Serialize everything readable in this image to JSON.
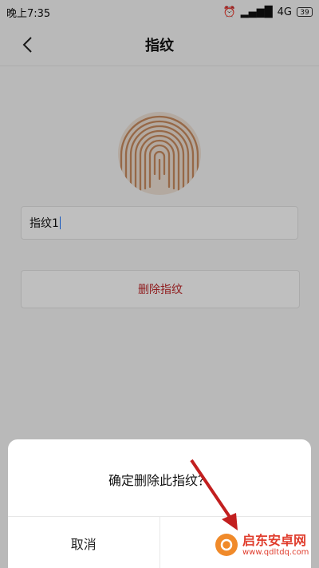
{
  "status_bar": {
    "time": "晚上7:35",
    "network": "4G",
    "battery": "39"
  },
  "header": {
    "title": "指纹",
    "back_icon": "chevron-left-icon"
  },
  "fingerprint": {
    "icon": "fingerprint-icon",
    "color": "#d8a37f"
  },
  "name_field": {
    "value": "指纹1"
  },
  "delete_button": {
    "label": "删除指纹",
    "color": "#c0292b"
  },
  "dialog": {
    "message": "确定删除此指纹？",
    "cancel_label": "取消",
    "confirm_label": ""
  },
  "watermark": {
    "name": "启东安卓网",
    "url": "www.qdltdq.com"
  }
}
